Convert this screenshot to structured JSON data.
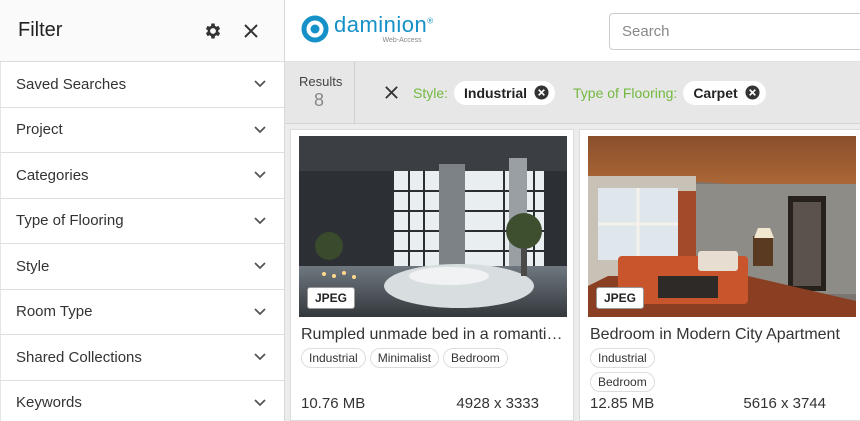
{
  "filter": {
    "title": "Filter",
    "items": [
      {
        "label": "Saved Searches"
      },
      {
        "label": "Project"
      },
      {
        "label": "Categories"
      },
      {
        "label": "Type of Flooring"
      },
      {
        "label": "Style"
      },
      {
        "label": "Room Type"
      },
      {
        "label": "Shared Collections"
      },
      {
        "label": "Keywords"
      }
    ]
  },
  "brand": {
    "name": "daminion",
    "trademark": "®",
    "tagline": "Web-Access",
    "color": "#1591c8"
  },
  "search": {
    "placeholder": "Search",
    "value": ""
  },
  "results": {
    "label": "Results",
    "count": "8",
    "active_filters": [
      {
        "facet": "Style:",
        "value": "Industrial"
      },
      {
        "facet": "Type of Flooring:",
        "value": "Carpet"
      }
    ],
    "facet_color": "#73b940"
  },
  "cards": [
    {
      "format": "JPEG",
      "title": "Rumpled unmade bed in a romantic loft",
      "tags": [
        "Industrial",
        "Minimalist",
        "Bedroom"
      ],
      "file_size": "10.76 MB",
      "dimensions": "4928 x 3333"
    },
    {
      "format": "JPEG",
      "title": "Bedroom in Modern City Apartment",
      "tags": [
        "Industrial",
        "Bedroom"
      ],
      "file_size": "12.85 MB",
      "dimensions": "5616 x 3744"
    }
  ]
}
